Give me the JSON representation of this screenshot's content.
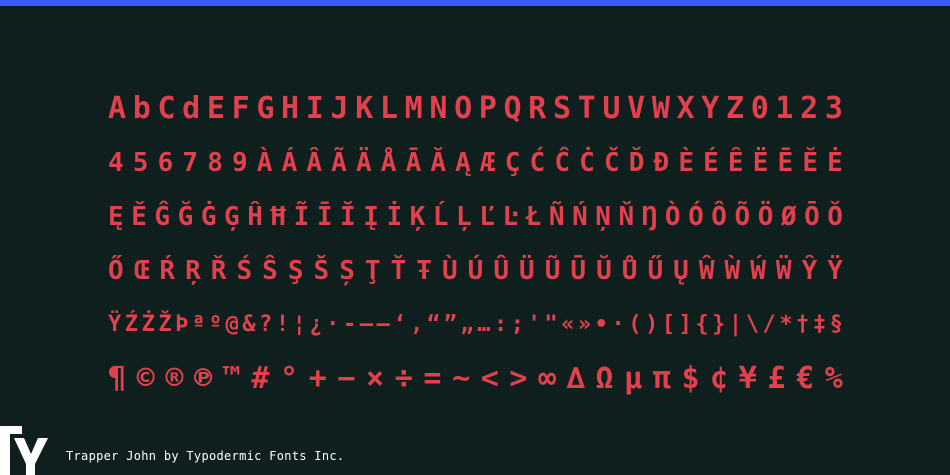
{
  "glyph_rows": [
    "AbCdEFGHIJKLMNOPQRSTUVWXYZ0123",
    "456789ÀÁÂÃÄÅĀĂĄÆÇĆĈĊČĎĐÈÉÊËĒĔĖ",
    "ĘĚĜĞĠĢĤĦĨĪĬĮİĶĹĻĽĿŁÑŃŅŇŊÒÓÔÕÖØŌŎ",
    "ŐŒŔŖŘŚŜŞŠȘŢŤŦÙÚÛÜŨŪŬŮŰŲŴẀẂẄŶŸ",
    "ŸŹŻŽÞªº@&?!¦¿·-–—‘‚“”„…:;'\"«»•·()[]{}|\\/*†‡§",
    "¶©®℗™#°+−×÷=~<>∞∆Ωμπ$¢¥£€%"
  ],
  "caption": "Trapper John by Typodermic Fonts Inc.",
  "colors": {
    "background": "#0e1f1e",
    "glyph": "#e3404d",
    "top_bar": "#3b5bff",
    "logo": "#ffffff"
  },
  "logo_icon": "typodermic-ty-logo"
}
